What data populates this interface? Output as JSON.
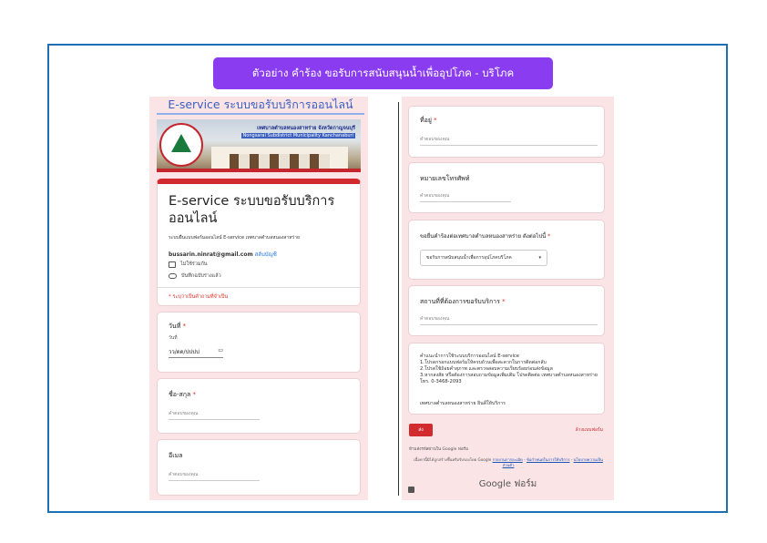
{
  "banner": {
    "title": "ตัวอย่าง คำร้อง ขอรับการสนับสนุนน้ำเพื่ออุปโภค - บริโภค"
  },
  "left": {
    "page_title": "E-service ระบบขอรับบริการออนไลน์",
    "header": {
      "line1": "เทศบาลตำบลหนองสาหร่าย จังหวัดกาญจนบุรี",
      "line2": "Nongsarai Subdistrict Municipality Kanchanaburi"
    },
    "form_title": "E-service ระบบขอรับบริการออนไลน์",
    "form_desc": "ระบบยื่นแบบฟอร์มออนไลน์ E-service เทศบาลตำบลหนองสาหร่าย",
    "account_email": "bussarin.ninrat@gmail.com",
    "switch_account": "สลับบัญชี",
    "not_shared": "ไม่ใช้ร่วมกัน",
    "draft_saved": "บันทึกฉบับร่างแล้ว",
    "required_note": "* ระบุว่าเป็นคำถามที่จำเป็น",
    "date_q": {
      "title": "วันที่",
      "sub": "วันที่",
      "value": "วว/ดด/ปปปป"
    },
    "name_q": {
      "title": "ชื่อ-สกุล",
      "placeholder": "คำตอบของคุณ"
    },
    "email_q": {
      "title": "อีเมล",
      "placeholder": "คำตอบของคุณ"
    }
  },
  "right": {
    "address_q": {
      "title": "ที่อยู่",
      "placeholder": "คำตอบของคุณ"
    },
    "phone_q": {
      "title": "หมายเลขโทรศัพท์",
      "placeholder": "คำตอบของคุณ"
    },
    "request_q": {
      "title": "ขอยื่นคำร้องต่อเทศบาลตำบลหนองสาหร่าย ดังต่อไปนี้",
      "selected": "ขอรับการสนับสนุนน้ำเพื่อการอุปโภคบริโภค"
    },
    "place_q": {
      "title": "สถานที่ที่ต้องการขอรับบริการ",
      "placeholder": "คำตอบของคุณ"
    },
    "info": {
      "body": "คำแนะนำการใช้ระบบบริการออนไลน์ E-service\n1.โปรดกรอกแบบฟอร์มให้ครบถ้วนเพื่อสะดวกในการติดต่อกลับ\n2.โปรดใช้ถ้อยคำสุภาพ และตรวจสอบความเรียบร้อยก่อนส่งข้อมูล\n3.หากสงสัย หรือต้องการสอบถามข้อมูลเพิ่มเติม โปรดติดต่อ เทศบาลตำบลหนองสาหร่าย โทร. 0-3468-2093",
      "thanks": "เทศบาลตำบลหนองสาหร่าย ยินดีให้บริการ"
    },
    "submit": "ส่ง",
    "clear": "ล้างแบบฟอร์ม",
    "never_submit": "ห้ามส่งรหัสผ่านใน Google ฟอร์ม",
    "legal_prefix": "เนื้อหานี้มิได้ถูกสร้างขึ้นหรือรับรองโดย Google",
    "legal_report": "รายงานการละเมิด",
    "legal_terms": "ข้อกำหนดในการให้บริการ",
    "legal_privacy": "นโยบายความเป็นส่วนตัว",
    "brand": "Google ฟอร์ม"
  }
}
